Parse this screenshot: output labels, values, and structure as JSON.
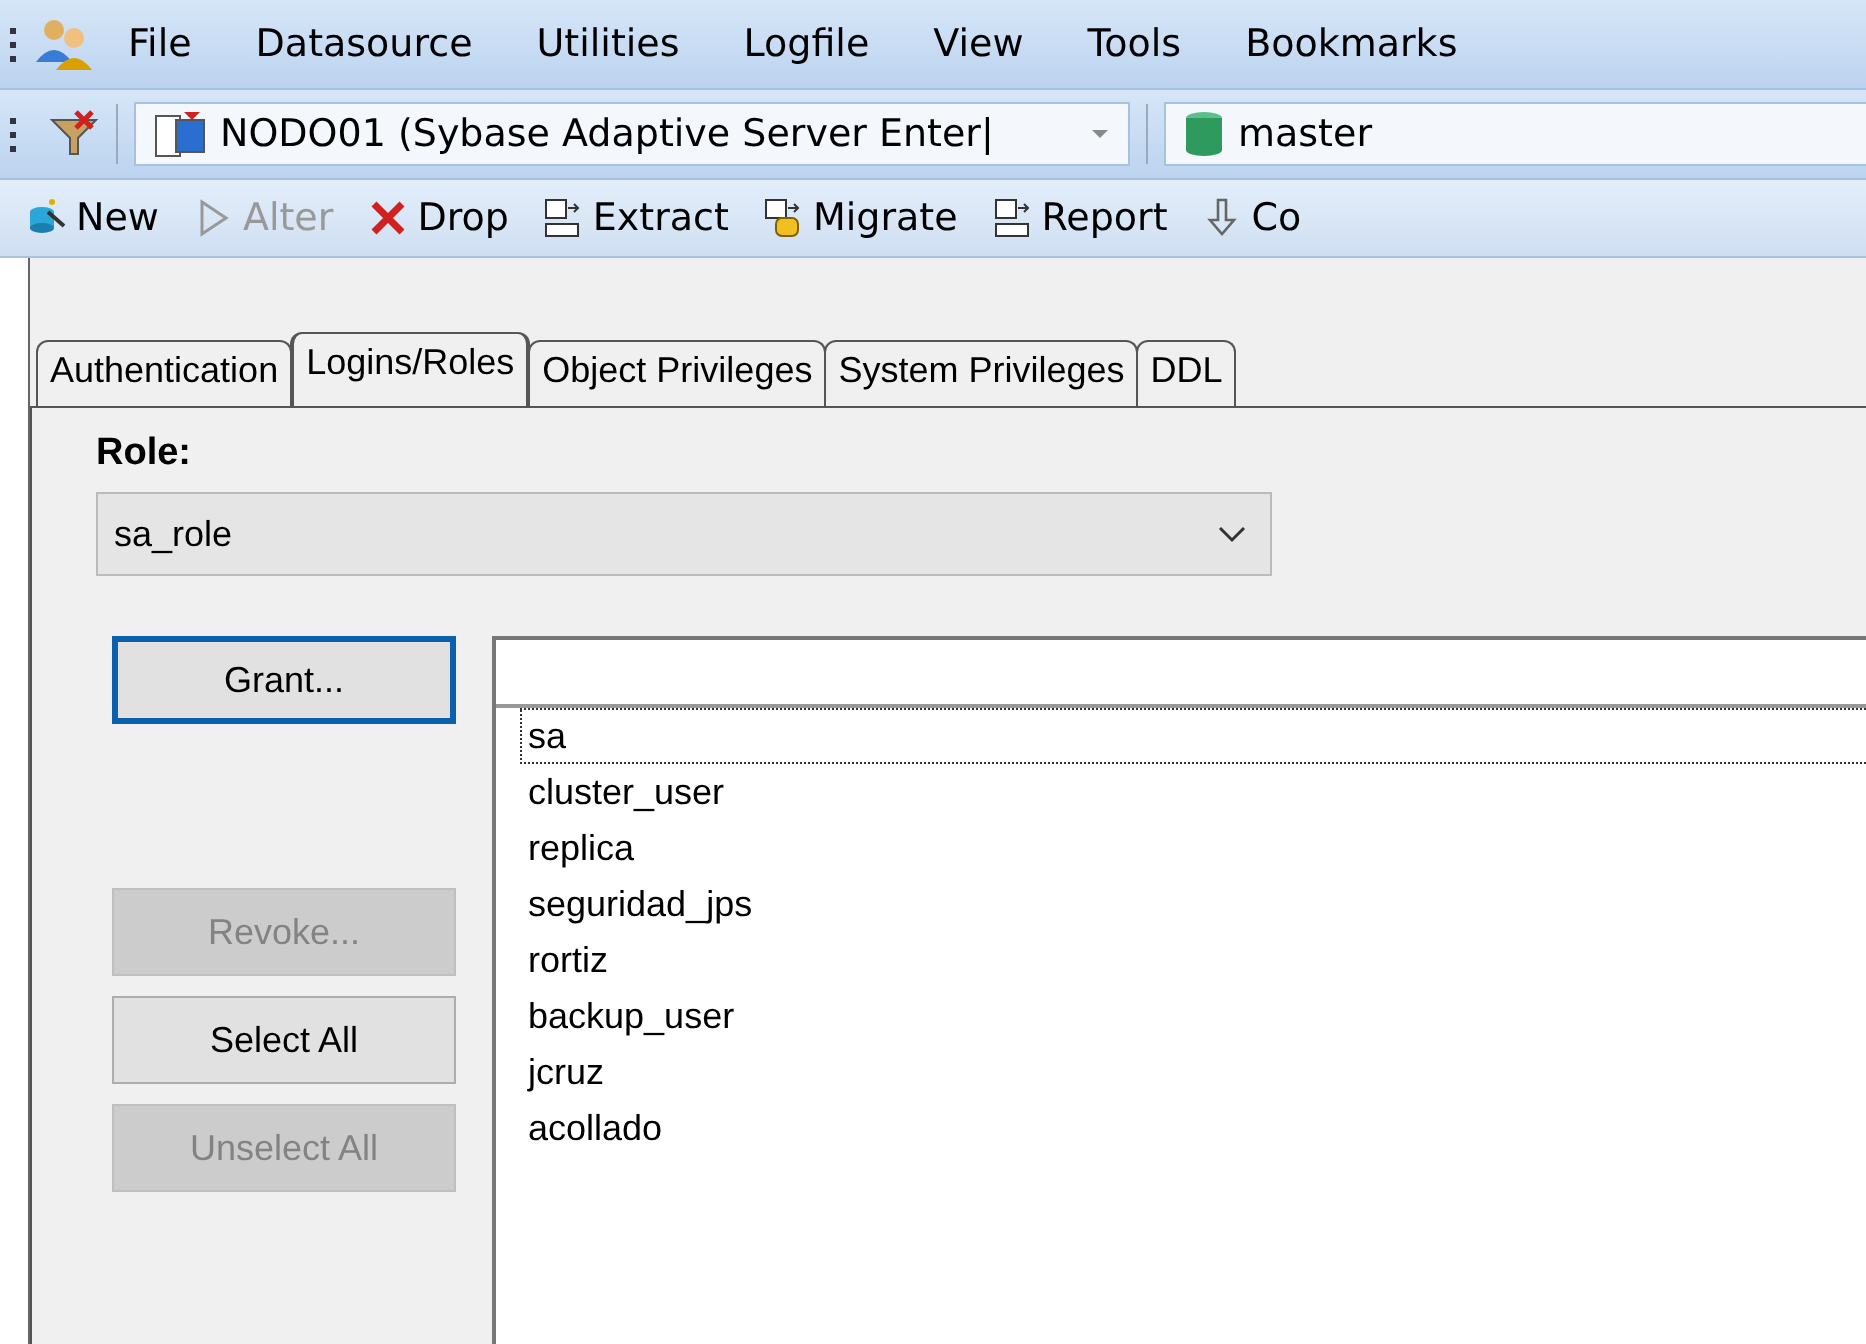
{
  "menu_bar": [
    {
      "label": "File"
    },
    {
      "label": "Datasource"
    },
    {
      "label": "Utilities"
    },
    {
      "label": "Logfile"
    },
    {
      "label": "View"
    },
    {
      "label": "Tools"
    },
    {
      "label": "Bookmarks"
    }
  ],
  "connection_bar": {
    "server": "NODO01 (Sybase Adaptive Server Enter|",
    "database": "master"
  },
  "toolbar": [
    {
      "label": "New",
      "disabled": false
    },
    {
      "label": "Alter",
      "disabled": true
    },
    {
      "label": "Drop",
      "disabled": false
    },
    {
      "label": "Extract",
      "disabled": false
    },
    {
      "label": "Migrate",
      "disabled": false
    },
    {
      "label": "Report",
      "disabled": false
    },
    {
      "label": "Co",
      "disabled": false
    }
  ],
  "tabs": [
    {
      "label": "Authentication",
      "selected": false
    },
    {
      "label": "Logins/Roles",
      "selected": true
    },
    {
      "label": "Object Privileges",
      "selected": false
    },
    {
      "label": "System Privileges",
      "selected": false
    },
    {
      "label": "DDL",
      "selected": false
    }
  ],
  "role": {
    "label": "Role:",
    "value": "sa_role"
  },
  "buttons": [
    {
      "label": "Grant...",
      "disabled": false,
      "focused": true
    },
    {
      "label": "Revoke...",
      "disabled": true,
      "focused": false
    },
    {
      "label": "Select All",
      "disabled": false,
      "focused": false
    },
    {
      "label": "Unselect All",
      "disabled": true,
      "focused": false
    }
  ],
  "logins": [
    {
      "name": "sa",
      "focused": true
    },
    {
      "name": "cluster_user",
      "focused": false
    },
    {
      "name": "replica",
      "focused": false
    },
    {
      "name": "seguridad_jps",
      "focused": false
    },
    {
      "name": "rortiz",
      "focused": false
    },
    {
      "name": "backup_user",
      "focused": false
    },
    {
      "name": "jcruz",
      "focused": false
    },
    {
      "name": "acollado",
      "focused": false
    }
  ]
}
